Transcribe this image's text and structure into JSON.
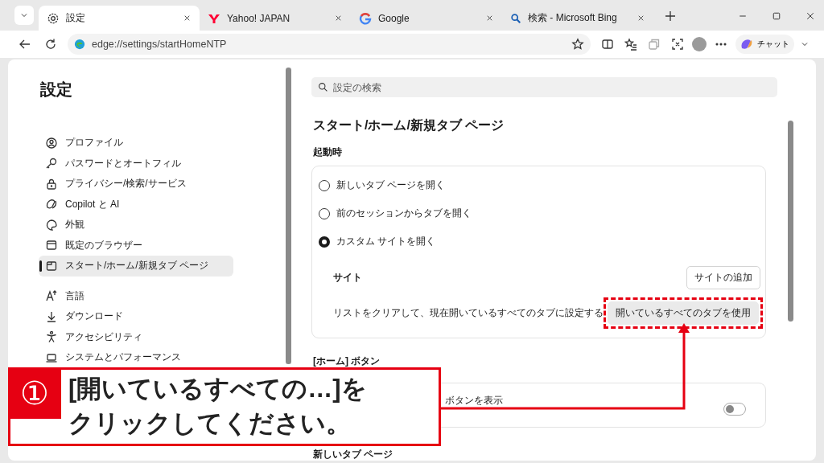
{
  "tabs": [
    {
      "label": "設定",
      "selected": true,
      "kind": "gear"
    },
    {
      "label": "Yahoo! JAPAN",
      "selected": false,
      "kind": "yahoo"
    },
    {
      "label": "Google",
      "selected": false,
      "kind": "google"
    },
    {
      "label": "検索 - Microsoft Bing",
      "selected": false,
      "kind": "search"
    }
  ],
  "address": "edge://settings/startHomeNTP",
  "copilot_label": "チャット",
  "sidebar": {
    "title": "設定",
    "groups": [
      [
        {
          "label": "プロファイル",
          "kind": "profile",
          "selected": false
        },
        {
          "label": "パスワードとオートフィル",
          "kind": "key",
          "selected": false
        },
        {
          "label": "プライバシー/検索/サービス",
          "kind": "lock",
          "selected": false
        },
        {
          "label": "Copilot と AI",
          "kind": "copilot",
          "selected": false
        },
        {
          "label": "外観",
          "kind": "palette",
          "selected": false
        },
        {
          "label": "既定のブラウザー",
          "kind": "browser",
          "selected": false
        },
        {
          "label": "スタート/ホーム/新規タブ ページ",
          "kind": "page",
          "selected": true
        }
      ],
      [
        {
          "label": "言語",
          "kind": "language",
          "selected": false
        },
        {
          "label": "ダウンロード",
          "kind": "download",
          "selected": false
        },
        {
          "label": "アクセシビリティ",
          "kind": "accessibility",
          "selected": false
        },
        {
          "label": "システムとパフォーマンス",
          "kind": "laptop",
          "selected": false
        }
      ]
    ]
  },
  "search": {
    "placeholder": "設定の検索"
  },
  "page_title": "スタート/ホーム/新規タブ ページ",
  "startup": {
    "label": "起動時",
    "options": [
      {
        "label": "新しいタブ ページを開く",
        "selected": false
      },
      {
        "label": "前のセッションからタブを開く",
        "selected": false
      },
      {
        "label": "カスタム サイトを開く",
        "selected": true
      }
    ],
    "sites_label": "サイト",
    "add_button": "サイトの追加",
    "clear_text": "リストをクリアして、現在開いているすべてのタブに設定する",
    "use_all_button": "開いているすべてのタブを使用"
  },
  "home_button": {
    "label": "[ホーム] ボタン",
    "toggle_title": "ボタンを表示",
    "on": false
  },
  "new_tab": {
    "label": "新しいタブ ページ"
  },
  "callout": {
    "number": "①",
    "lines": [
      "[開いているすべての…]を",
      "クリックしてください。"
    ]
  }
}
